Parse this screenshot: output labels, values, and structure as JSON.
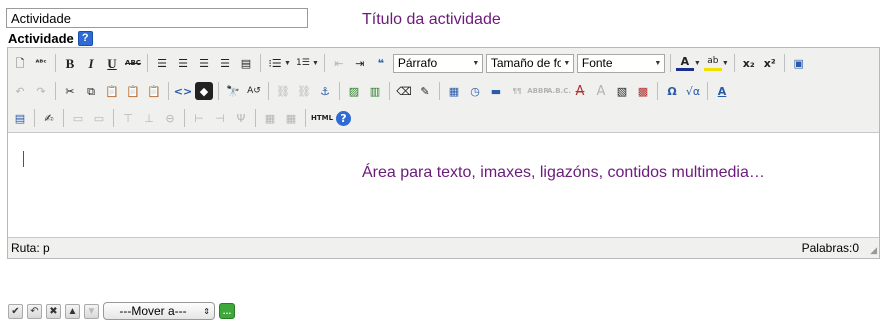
{
  "title_field": {
    "value": "Actividade"
  },
  "annotations": {
    "title_note": "Título da actividade",
    "area_note": "Área para  texto, imaxes, ligazóns, contidos multimedia…"
  },
  "field_label": "Actividade",
  "help_icon_text": "?",
  "toolbar": {
    "format_select": "Párrafo",
    "size_select": "Tamaño de fon",
    "font_select": "Fonte"
  },
  "status": {
    "path": "Ruta: p",
    "words": "Palabras:0"
  },
  "move_select": {
    "selected": "---Mover a---"
  },
  "colors": {
    "annotation": "#6b1b7a",
    "toolbar_bg": "#f0f0ee",
    "help_blue": "#2e6bd4",
    "green_icon": "#3fa83a"
  }
}
